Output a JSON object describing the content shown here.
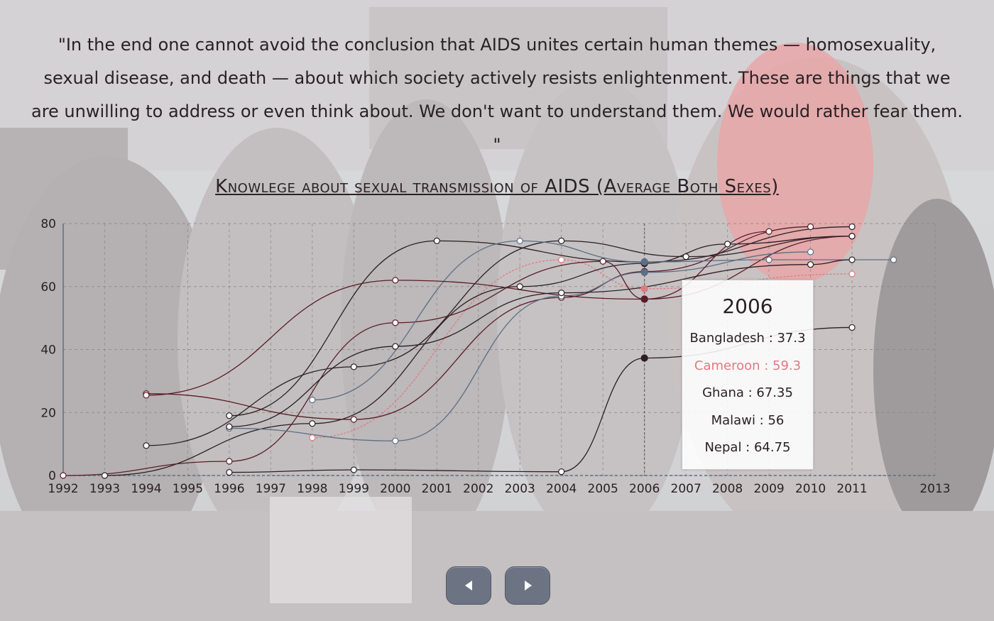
{
  "quote": "\"In the end one cannot avoid the conclusion that AIDS unites certain human themes — homosexuality, sexual disease, and death — about which society actively resists enlightenment. These are things that we are unwilling to address or even think about. We don't want to understand them. We would rather fear them. \"",
  "chart_title": "Knowlege about sexual transmission of AIDS (Average Both Sexes)",
  "tooltip": {
    "year": "2006",
    "rows": [
      {
        "label": "Bangladesh : 37.3",
        "highlight": false
      },
      {
        "label": "Cameroon : 59.3",
        "highlight": true
      },
      {
        "label": "Ghana : 67.35",
        "highlight": false
      },
      {
        "label": "Malawi : 56",
        "highlight": false
      },
      {
        "label": "Nepal : 64.75",
        "highlight": false
      }
    ]
  },
  "nav": {
    "prev_icon": "triangle-left-icon",
    "next_icon": "triangle-right-icon"
  },
  "colors": {
    "highlight": "#e07a80",
    "dark": "#2b1f24",
    "maroon": "#5a1d2a",
    "blue": "#5b6f86"
  },
  "chart_data": {
    "type": "line",
    "title": "Knowlege about sexual transmission of AIDS (Average Both Sexes)",
    "x_ticks": [
      "1992",
      "1993",
      "1994",
      "1995",
      "1996",
      "1997",
      "1998",
      "1999",
      "2000",
      "2001",
      "2002",
      "2003",
      "2004",
      "2005",
      "2006",
      "2007",
      "2008",
      "2009",
      "2010",
      "2011",
      "2013"
    ],
    "y_ticks": [
      "0",
      "20",
      "40",
      "60",
      "80"
    ],
    "ylim": [
      0,
      80
    ],
    "grid": true,
    "hover_year": 2006,
    "series": [
      {
        "name": "Bangladesh",
        "color": "#2b1f24",
        "points": [
          [
            1996,
            1
          ],
          [
            1999,
            1.8
          ],
          [
            2004,
            1.2
          ],
          [
            2006,
            37.3
          ],
          [
            2011,
            47
          ]
        ]
      },
      {
        "name": "Cameroon",
        "color": "#e07a80",
        "points": [
          [
            1998,
            12
          ],
          [
            2004,
            68.5
          ],
          [
            2006,
            59.3
          ],
          [
            2011,
            64
          ]
        ]
      },
      {
        "name": "Ghana",
        "color": "#2b1f24",
        "points": [
          [
            1993,
            0
          ],
          [
            1998,
            16.5
          ],
          [
            2003,
            60
          ],
          [
            2006,
            67.35
          ],
          [
            2008,
            73.5
          ],
          [
            2011,
            76
          ]
        ]
      },
      {
        "name": "Malawi",
        "color": "#5a1d2a",
        "points": [
          [
            1992,
            0
          ],
          [
            1996,
            4.5
          ],
          [
            2000,
            48.5
          ],
          [
            2005,
            68
          ],
          [
            2006,
            56
          ],
          [
            2011,
            76
          ]
        ]
      },
      {
        "name": "Nepal",
        "color": "#5a1d2a",
        "points": [
          [
            1994,
            26
          ],
          [
            1999,
            17.8
          ],
          [
            2004,
            56.5
          ],
          [
            2006,
            64.75
          ],
          [
            2010,
            79
          ]
        ]
      },
      {
        "name": "",
        "color": "#2b1f24",
        "points": [
          [
            1996,
            19
          ],
          [
            2001,
            74.5
          ],
          [
            2006,
            67.8
          ],
          [
            2011,
            79
          ]
        ]
      },
      {
        "name": "",
        "color": "#5b6f86",
        "points": [
          [
            1996,
            15
          ],
          [
            2000,
            11
          ],
          [
            2004,
            57
          ],
          [
            2006,
            64.5
          ],
          [
            2010,
            71
          ]
        ]
      },
      {
        "name": "",
        "color": "#2b1f24",
        "points": [
          [
            1994,
            9.5
          ],
          [
            1999,
            34.5
          ],
          [
            2004,
            74.5
          ],
          [
            2007,
            69.5
          ],
          [
            2011,
            76
          ]
        ]
      },
      {
        "name": "",
        "color": "#5b6f86",
        "points": [
          [
            1998,
            24
          ],
          [
            2003,
            74.5
          ],
          [
            2006,
            67.8
          ],
          [
            2009,
            68.5
          ],
          [
            2012,
            68.5
          ]
        ]
      },
      {
        "name": "",
        "color": "#5a1d2a",
        "points": [
          [
            1994,
            25.5
          ],
          [
            2000,
            62
          ],
          [
            2006,
            56
          ],
          [
            2009,
            77.5
          ]
        ]
      },
      {
        "name": "",
        "color": "#2b1f24",
        "points": [
          [
            1996,
            15.5
          ],
          [
            2000,
            41
          ],
          [
            2004,
            58
          ],
          [
            2010,
            67
          ],
          [
            2011,
            68.5
          ]
        ]
      }
    ]
  }
}
